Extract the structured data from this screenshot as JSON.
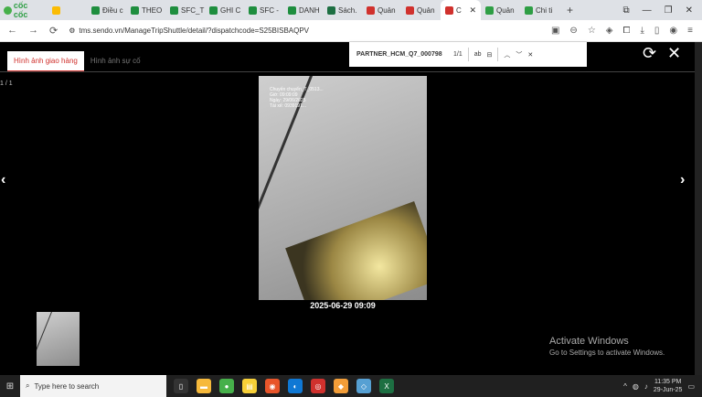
{
  "browser": {
    "brand": "cốc cốc",
    "tabs": [
      {
        "label": "Điều c",
        "color": "#1e8e3e"
      },
      {
        "label": "THEO",
        "color": "#1e8e3e"
      },
      {
        "label": "SFC_T",
        "color": "#1e8e3e"
      },
      {
        "label": "GHI C",
        "color": "#1e8e3e"
      },
      {
        "label": "SFC -",
        "color": "#1e8e3e"
      },
      {
        "label": "DANH",
        "color": "#1e8e3e"
      },
      {
        "label": "Sách.",
        "color": "#1d6f42"
      },
      {
        "label": "Quản",
        "color": "#d0312d"
      },
      {
        "label": "Quản",
        "color": "#d0312d"
      },
      {
        "label": "C",
        "color": "#d0312d",
        "active": true
      },
      {
        "label": "Quản",
        "color": "#2e9e44"
      },
      {
        "label": "Chi ti",
        "color": "#2e9e44"
      }
    ],
    "url": "tms.sendo.vn/ManageTripShuttle/detail/?dispatchcode=S25BISBAQPV"
  },
  "viewer": {
    "tab_delivery": "Hình ảnh giao hàng",
    "tab_incident": "Hình ảnh sự cố",
    "counter": "1 / 1",
    "caption": "2025-06-29 09:09",
    "photo_meta": [
      "Chuyến chuyển_T_0513...",
      "Giờ: 09:09:09",
      "Ngày: 29/06/2025",
      "Tài xế: 0939191..."
    ]
  },
  "find": {
    "query": "PARTNER_HCM_Q7_000798",
    "count": "1/1",
    "ab": "ab"
  },
  "watermark": {
    "title": "Activate Windows",
    "subtitle": "Go to Settings to activate Windows."
  },
  "taskbar": {
    "search_placeholder": "Type here to search",
    "time": "11:35 PM",
    "date": "29-Jun-25"
  }
}
